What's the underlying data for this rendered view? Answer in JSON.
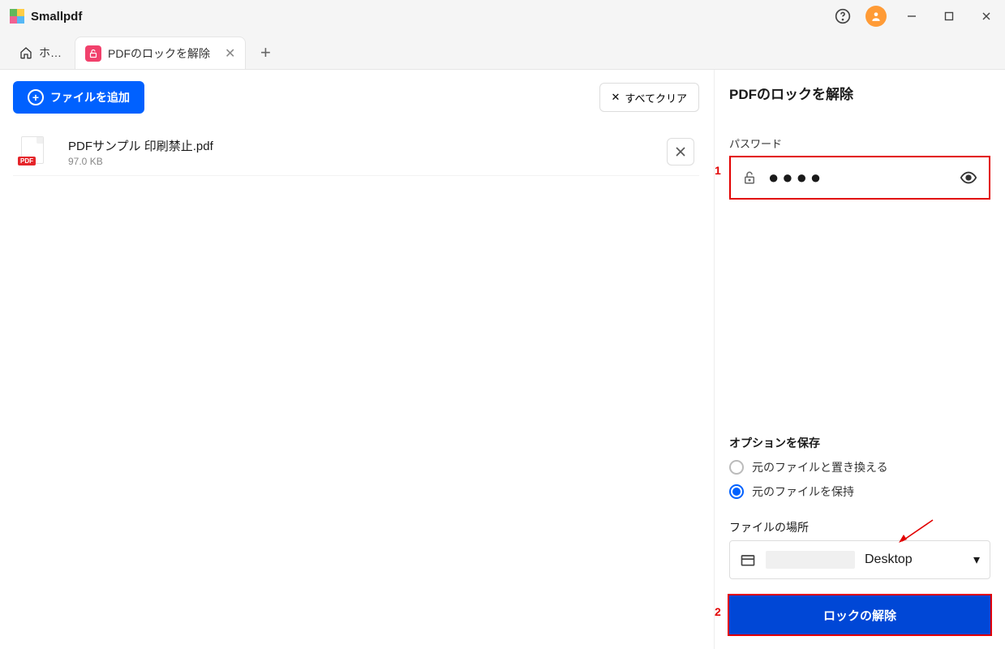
{
  "brand": "Smallpdf",
  "tabs": {
    "home_label": "ホ…",
    "active_label": "PDFのロックを解除"
  },
  "toolbar": {
    "add_label": "ファイルを追加",
    "clear_label": "すべてクリア"
  },
  "files": [
    {
      "name": "PDFサンプル 印刷禁止.pdf",
      "size": "97.0 KB",
      "badge": "PDF"
    }
  ],
  "panel": {
    "title": "PDFのロックを解除",
    "password_label": "パスワード",
    "password_masked": "●●●●",
    "save_section": "オプションを保存",
    "radio_replace": "元のファイルと置き換える",
    "radio_keep": "元のファイルを保持",
    "location_label": "ファイルの場所",
    "location_value": "Desktop",
    "action": "ロックの解除",
    "annotation1": "1",
    "annotation2": "2"
  }
}
